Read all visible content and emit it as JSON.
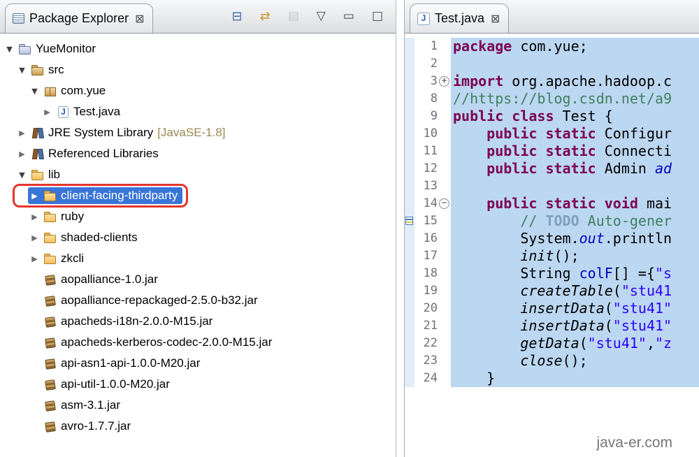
{
  "colors": {
    "kw": "#7b0052",
    "str": "#2a00ff",
    "comment": "#3f7f5f",
    "todo": "#7f9fbf",
    "staticfield": "#0000c0",
    "selbg": "#bcd7f1",
    "treesel": "#3875d7",
    "annred": "#e6362b",
    "suffix": "#9a8750"
  },
  "package_explorer": {
    "tab": {
      "label": "Package Explorer",
      "close_glyph": "⊠"
    },
    "toolbar": {
      "collapse_all": "⊟",
      "link_with_editor": "⇄",
      "focus_task": "▤",
      "view_menu": "▽",
      "minimize": "▭",
      "maximize": "□"
    },
    "arrow_glyphs": {
      "expanded": "▼",
      "collapsed": "▶"
    },
    "tree": [
      {
        "label": "YueMonitor",
        "level": 0,
        "state": "expanded",
        "icon": "project"
      },
      {
        "label": "src",
        "level": 1,
        "state": "expanded",
        "icon": "src"
      },
      {
        "label": "com.yue",
        "level": 2,
        "state": "expanded",
        "icon": "package"
      },
      {
        "label": "Test.java",
        "level": 3,
        "state": "collapsed",
        "icon": "java"
      },
      {
        "label": "JRE System Library ",
        "suffix": "[JavaSE-1.8]",
        "level": 1,
        "state": "collapsed",
        "icon": "library"
      },
      {
        "label": "Referenced Libraries",
        "level": 1,
        "state": "collapsed",
        "icon": "library"
      },
      {
        "label": "lib",
        "level": 1,
        "state": "expanded",
        "icon": "folder"
      },
      {
        "label": "client-facing-thirdparty",
        "level": 2,
        "state": "collapsed",
        "icon": "folder",
        "selected": true,
        "annotated": true
      },
      {
        "label": "ruby",
        "level": 2,
        "state": "collapsed",
        "icon": "folder"
      },
      {
        "label": "shaded-clients",
        "level": 2,
        "state": "collapsed",
        "icon": "folder"
      },
      {
        "label": "zkcli",
        "level": 2,
        "state": "collapsed",
        "icon": "folder"
      },
      {
        "label": "aopalliance-1.0.jar",
        "level": 2,
        "state": "none",
        "icon": "jar"
      },
      {
        "label": "aopalliance-repackaged-2.5.0-b32.jar",
        "level": 2,
        "state": "none",
        "icon": "jar"
      },
      {
        "label": "apacheds-i18n-2.0.0-M15.jar",
        "level": 2,
        "state": "none",
        "icon": "jar"
      },
      {
        "label": "apacheds-kerberos-codec-2.0.0-M15.jar",
        "level": 2,
        "state": "none",
        "icon": "jar"
      },
      {
        "label": "api-asn1-api-1.0.0-M20.jar",
        "level": 2,
        "state": "none",
        "icon": "jar"
      },
      {
        "label": "api-util-1.0.0-M20.jar",
        "level": 2,
        "state": "none",
        "icon": "jar"
      },
      {
        "label": "asm-3.1.jar",
        "level": 2,
        "state": "none",
        "icon": "jar"
      },
      {
        "label": "avro-1.7.7.jar",
        "level": 2,
        "state": "none",
        "icon": "jar"
      }
    ]
  },
  "editor": {
    "tab": {
      "label": "Test.java",
      "close_glyph": "⊠",
      "file_icon_letter": "J"
    },
    "marker_line": "15",
    "watermark": "java-er.com",
    "lines": [
      {
        "num": "1",
        "seg": [
          [
            "kw",
            "package "
          ],
          [
            "pl",
            "com.yue;"
          ]
        ]
      },
      {
        "num": "2",
        "seg": []
      },
      {
        "num": "3",
        "fold": "+",
        "seg": [
          [
            "kw",
            "import "
          ],
          [
            "pl",
            "org.apache.hadoop.c"
          ]
        ]
      },
      {
        "num": "8",
        "seg": [
          [
            "com",
            "//https://blog.csdn.net/a9"
          ]
        ]
      },
      {
        "num": "9",
        "seg": [
          [
            "kw",
            "public class "
          ],
          [
            "pl",
            "Test {"
          ]
        ]
      },
      {
        "num": "10",
        "seg": [
          [
            "pl",
            "    "
          ],
          [
            "kw",
            "public static "
          ],
          [
            "pl",
            "Configur"
          ]
        ]
      },
      {
        "num": "11",
        "seg": [
          [
            "pl",
            "    "
          ],
          [
            "kw",
            "public static "
          ],
          [
            "pl",
            "Connecti"
          ]
        ]
      },
      {
        "num": "12",
        "seg": [
          [
            "pl",
            "    "
          ],
          [
            "kw",
            "public static "
          ],
          [
            "pl",
            "Admin "
          ],
          [
            "sif",
            "ad"
          ]
        ]
      },
      {
        "num": "13",
        "seg": []
      },
      {
        "num": "14",
        "fold": "−",
        "seg": [
          [
            "pl",
            "    "
          ],
          [
            "kw",
            "public static void "
          ],
          [
            "pl",
            "mai"
          ]
        ]
      },
      {
        "num": "15",
        "seg": [
          [
            "pl",
            "        "
          ],
          [
            "com",
            "// "
          ],
          [
            "todo",
            "TODO"
          ],
          [
            "com",
            " Auto-gener"
          ]
        ]
      },
      {
        "num": "16",
        "seg": [
          [
            "pl",
            "        System."
          ],
          [
            "sif",
            "out"
          ],
          [
            "pl",
            ".println"
          ]
        ]
      },
      {
        "num": "17",
        "seg": [
          [
            "pl",
            "        "
          ],
          [
            "sim",
            "init"
          ],
          [
            "pl",
            "();"
          ]
        ]
      },
      {
        "num": "18",
        "seg": [
          [
            "pl",
            "        String "
          ],
          [
            "var",
            "colF"
          ],
          [
            "pl",
            "[] ={"
          ],
          [
            "str",
            "\"s"
          ]
        ]
      },
      {
        "num": "19",
        "seg": [
          [
            "pl",
            "        "
          ],
          [
            "sim",
            "createTable"
          ],
          [
            "pl",
            "("
          ],
          [
            "str",
            "\"stu41"
          ]
        ]
      },
      {
        "num": "20",
        "seg": [
          [
            "pl",
            "        "
          ],
          [
            "sim",
            "insertData"
          ],
          [
            "pl",
            "("
          ],
          [
            "str",
            "\"stu41\""
          ]
        ]
      },
      {
        "num": "21",
        "seg": [
          [
            "pl",
            "        "
          ],
          [
            "sim",
            "insertData"
          ],
          [
            "pl",
            "("
          ],
          [
            "str",
            "\"stu41\""
          ]
        ]
      },
      {
        "num": "22",
        "seg": [
          [
            "pl",
            "        "
          ],
          [
            "sim",
            "getData"
          ],
          [
            "pl",
            "("
          ],
          [
            "str",
            "\"stu41\""
          ],
          [
            "pl",
            ","
          ],
          [
            "str",
            "\"z"
          ]
        ]
      },
      {
        "num": "23",
        "seg": [
          [
            "pl",
            "        "
          ],
          [
            "sim",
            "close"
          ],
          [
            "pl",
            "();"
          ]
        ]
      },
      {
        "num": "24",
        "seg": [
          [
            "pl",
            "    }"
          ]
        ]
      }
    ]
  }
}
